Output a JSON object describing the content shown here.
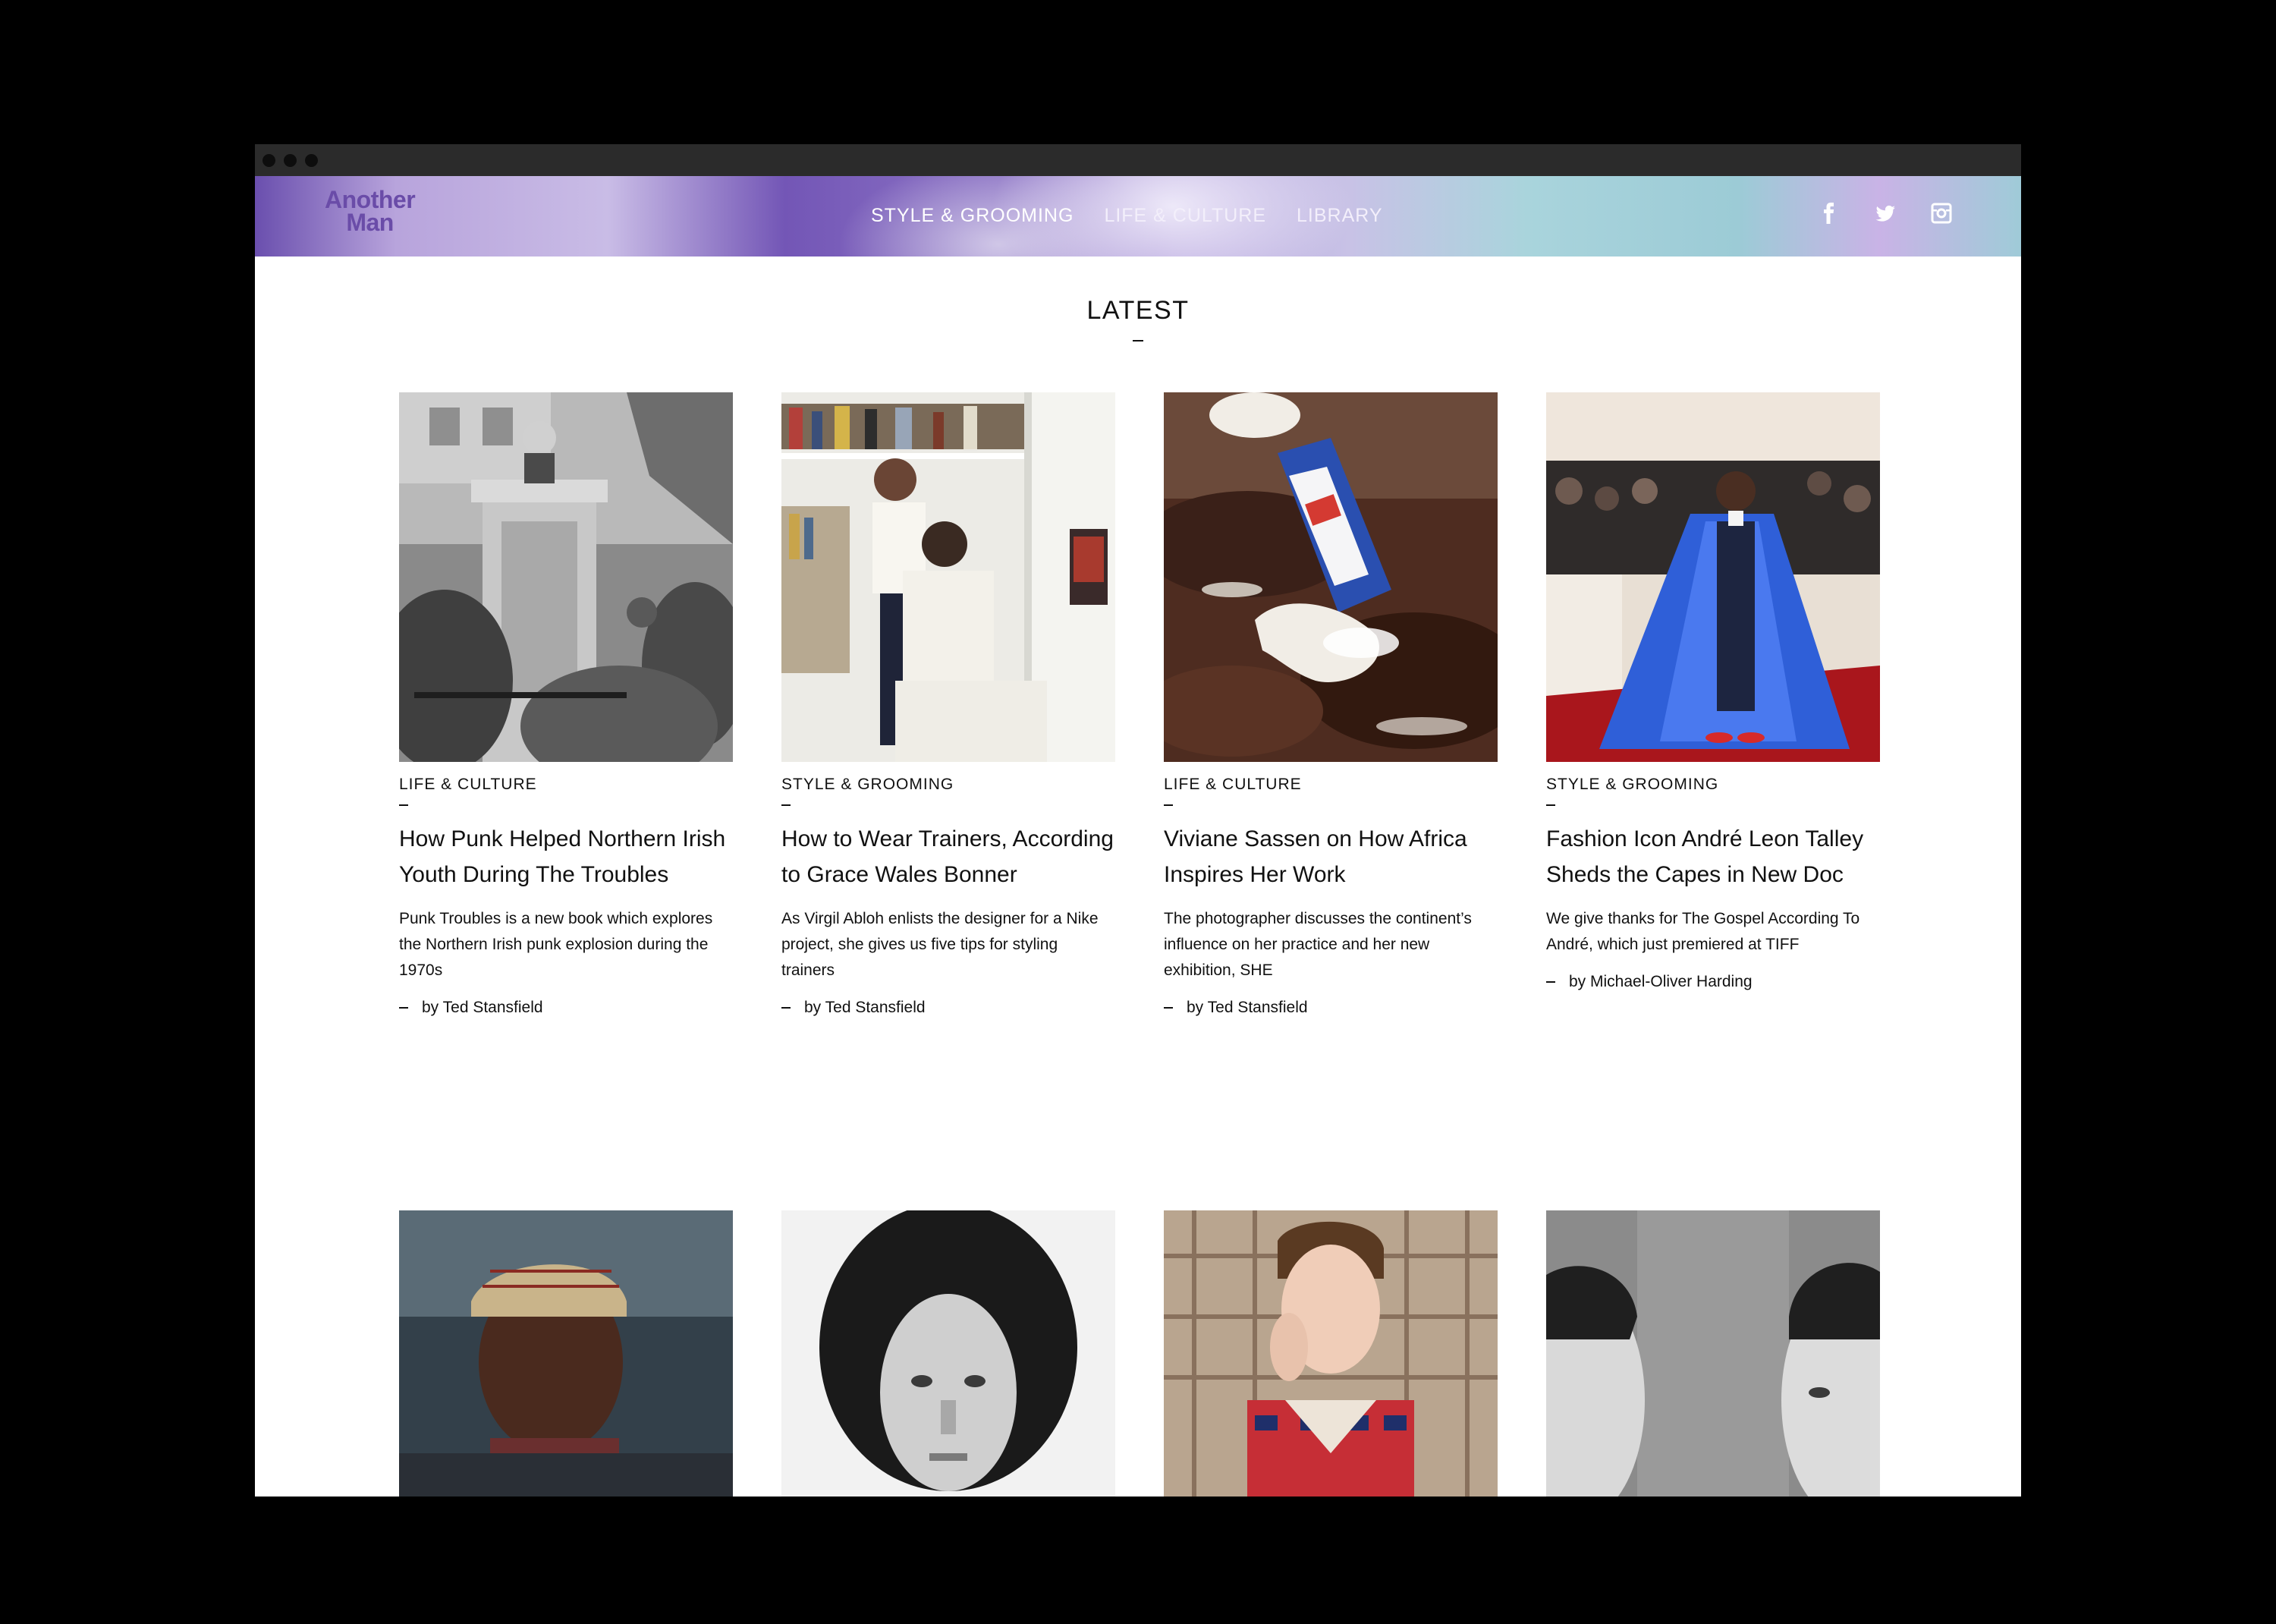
{
  "header": {
    "logo_line1": "Another",
    "logo_line2": "Man",
    "nav": [
      "STYLE & GROOMING",
      "LIFE & CULTURE",
      "LIBRARY"
    ],
    "social_icons": [
      "facebook-icon",
      "twitter-icon",
      "instagram-icon"
    ]
  },
  "section": {
    "title": "LATEST"
  },
  "articles": [
    {
      "category": "LIFE & CULTURE",
      "headline": "How Punk Helped Northern Irish Youth During The Troubles",
      "summary": "Punk Troubles is a new book which explores the Northern Irish punk explosion during the 1970s",
      "byline": "by Ted Stansfield"
    },
    {
      "category": "STYLE & GROOMING",
      "headline": "How to Wear Trainers, According to Grace Wales Bonner",
      "summary": "As Virgil Abloh enlists the designer for a Nike project, she gives us five tips for styling trainers",
      "byline": "by Ted Stansfield"
    },
    {
      "category": "LIFE & CULTURE",
      "headline": "Viviane Sassen on How Africa Inspires Her Work",
      "summary": "The photographer discusses the continent’s influence on her practice and her new exhibition, SHE",
      "byline": "by Ted Stansfield"
    },
    {
      "category": "STYLE & GROOMING",
      "headline": "Fashion Icon André Leon Talley Sheds the Capes in New Doc",
      "summary": "We give thanks for The Gospel According To André, which just premiered at TIFF",
      "byline": "by Michael-Oliver Harding"
    }
  ],
  "colors": {
    "logo": "#6a4ca8",
    "header_purple": "#7356b6",
    "header_teal": "#9ccbd6",
    "text": "#111111"
  }
}
